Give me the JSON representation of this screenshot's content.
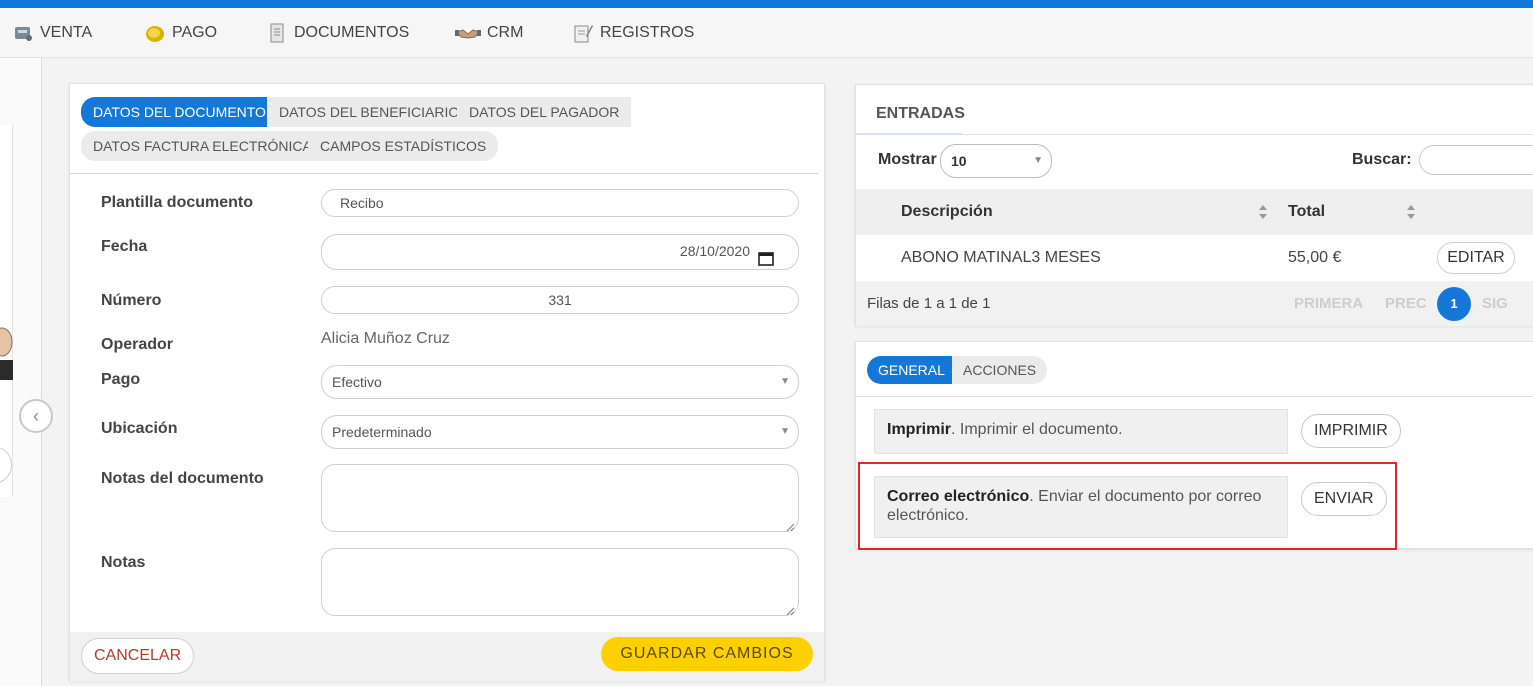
{
  "menu": {
    "items": [
      {
        "label": "VENTA",
        "icon": "sale-icon"
      },
      {
        "label": "PAGO",
        "icon": "coin-icon"
      },
      {
        "label": "DOCUMENTOS",
        "icon": "document-icon"
      },
      {
        "label": "CRM",
        "icon": "handshake-icon"
      },
      {
        "label": "REGISTROS",
        "icon": "register-icon"
      }
    ]
  },
  "document_tabs": [
    "DATOS DEL DOCUMENTO",
    "DATOS DEL BENEFICIARIO",
    "DATOS DEL PAGADOR",
    "DATOS FACTURA ELECTRÓNICA",
    "CAMPOS ESTADÍSTICOS"
  ],
  "form": {
    "plantilla": {
      "label": "Plantilla documento",
      "value": "Recibo"
    },
    "fecha": {
      "label": "Fecha",
      "value": "28/10/2020"
    },
    "numero": {
      "label": "Número",
      "value": "331"
    },
    "operador": {
      "label": "Operador",
      "value": "Alicia Muñoz Cruz"
    },
    "pago": {
      "label": "Pago",
      "value": "Efectivo"
    },
    "ubicacion": {
      "label": "Ubicación",
      "value": "Predeterminado"
    },
    "notas_documento": {
      "label": "Notas del documento",
      "value": ""
    },
    "notas": {
      "label": "Notas",
      "value": ""
    }
  },
  "footer": {
    "cancel": "CANCELAR",
    "save": "GUARDAR CAMBIOS"
  },
  "entries": {
    "title": "ENTRADAS",
    "show_label": "Mostrar",
    "show_value": "10",
    "search_label": "Buscar:",
    "columns": [
      "Descripción",
      "Total"
    ],
    "rows": [
      {
        "descripcion": "ABONO MATINAL3 MESES",
        "total": "55,00 €",
        "action": "EDITAR"
      }
    ],
    "rows_info": "Filas de 1 a 1 de 1",
    "pagination": {
      "first": "PRIMERA",
      "prev": "PREC",
      "current": "1",
      "next": "SIG"
    }
  },
  "actions": {
    "tabs": [
      "GENERAL",
      "ACCIONES"
    ],
    "items": [
      {
        "title": "Imprimir",
        "description": ". Imprimir el documento.",
        "button": "IMPRIMIR"
      },
      {
        "title": "Correo electrónico",
        "description": ". Enviar el documento por correo electrónico.",
        "button": "ENVIAR"
      }
    ]
  },
  "colors": {
    "accent": "#1478d8",
    "save": "#ffd000",
    "highlight": "#e0262a",
    "cancel_text": "#b23b2e"
  }
}
